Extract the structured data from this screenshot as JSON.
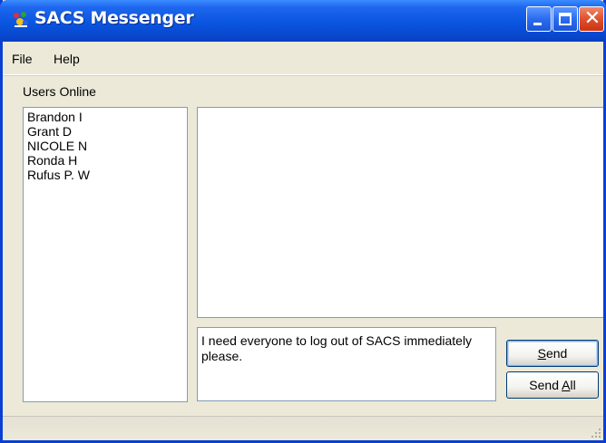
{
  "window": {
    "title": "SACS Messenger",
    "accent_color": "#0a55e0",
    "close_color": "#e0502c"
  },
  "titlebar_buttons": {
    "minimize_icon": "minimize-icon",
    "maximize_icon": "maximize-icon",
    "close_icon": "close-icon",
    "close_glyph": "✕"
  },
  "menu": {
    "file": "File",
    "help": "Help"
  },
  "users": {
    "label": "Users Online",
    "items": [
      "Brandon I",
      "Grant D",
      "NICOLE N",
      "Ronda H",
      "Rufus P. W"
    ]
  },
  "chat": {
    "history": ""
  },
  "compose": {
    "value": "I need everyone to log out of SACS immediately please."
  },
  "buttons": {
    "send_accel": "S",
    "send_rest": "end",
    "send_all_prefix": "Send ",
    "send_all_accel": "A",
    "send_all_rest": "ll"
  }
}
